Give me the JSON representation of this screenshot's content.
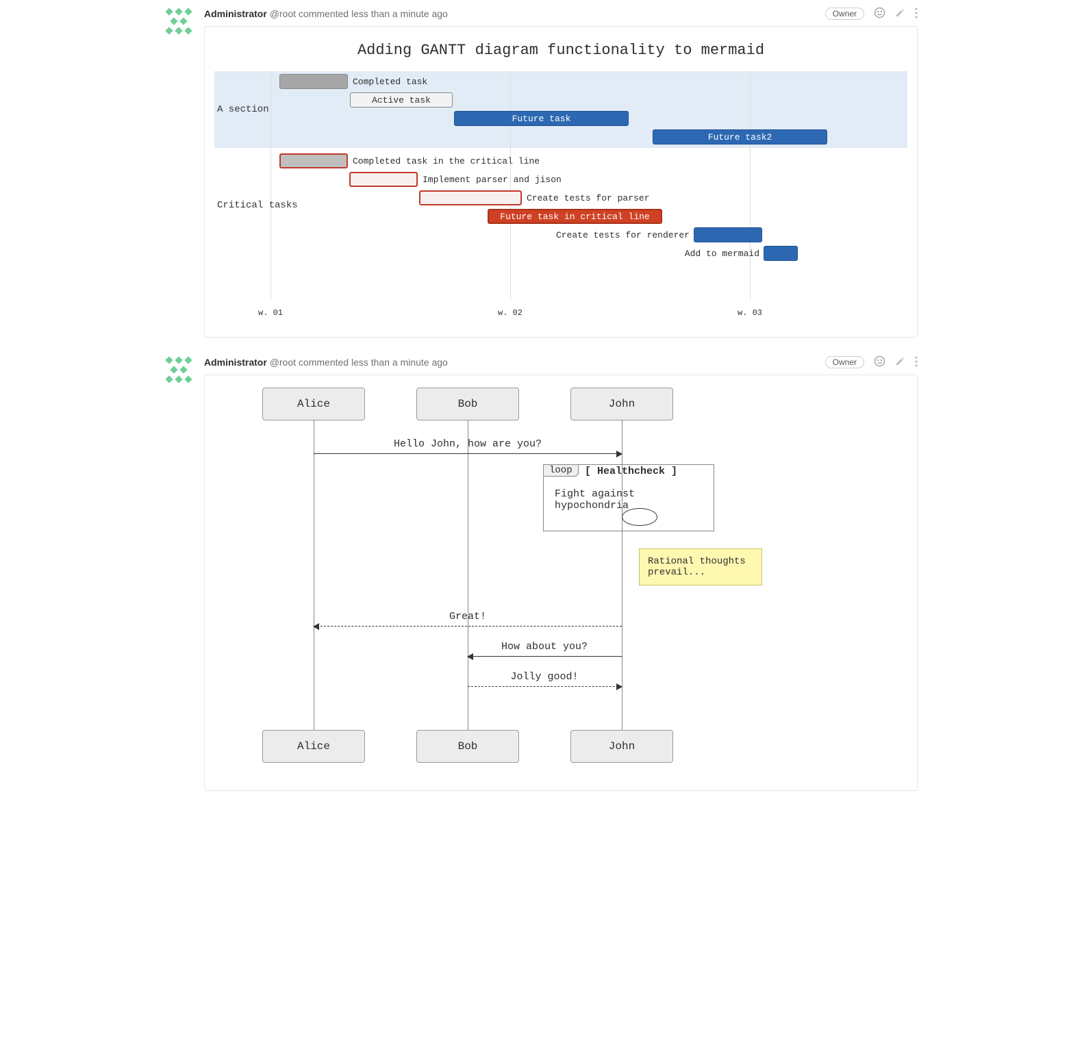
{
  "notes": [
    {
      "author": "Administrator",
      "handle": "@root",
      "meta": "commented less than a minute ago",
      "badge": "Owner"
    },
    {
      "author": "Administrator",
      "handle": "@root",
      "meta": "commented less than a minute ago",
      "badge": "Owner"
    }
  ],
  "gantt": {
    "title": "Adding GANTT diagram functionality to mermaid",
    "sections": [
      {
        "name": "A section",
        "tasks": [
          {
            "label": "Completed task",
            "kind": "done",
            "text_pos": "right"
          },
          {
            "label": "Active task",
            "kind": "active",
            "text_pos": "inside"
          },
          {
            "label": "Future task",
            "kind": "future",
            "text_pos": "inside"
          },
          {
            "label": "Future task2",
            "kind": "future",
            "text_pos": "inside"
          }
        ]
      },
      {
        "name": "Critical tasks",
        "tasks": [
          {
            "label": "Completed task in the critical line",
            "kind": "critdone",
            "text_pos": "right"
          },
          {
            "label": "Implement parser and jison",
            "kind": "critact",
            "text_pos": "right"
          },
          {
            "label": "Create tests for parser",
            "kind": "critact",
            "text_pos": "right"
          },
          {
            "label": "Future task in critical line",
            "kind": "crit",
            "text_pos": "inside"
          },
          {
            "label": "Create tests for renderer",
            "kind": "small",
            "text_pos": "left"
          },
          {
            "label": "Add to mermaid",
            "kind": "small",
            "text_pos": "left"
          }
        ]
      }
    ],
    "ticks": [
      "w. 01",
      "w. 02",
      "w. 03"
    ]
  },
  "seq": {
    "actors": [
      "Alice",
      "Bob",
      "John"
    ],
    "messages": [
      {
        "text": "Hello John, how are you?",
        "from": 0,
        "to": 2,
        "style": "solid"
      },
      {
        "text": "Great!",
        "from": 2,
        "to": 0,
        "style": "dashed"
      },
      {
        "text": "How about you?",
        "from": 2,
        "to": 1,
        "style": "solid"
      },
      {
        "text": "Jolly good!",
        "from": 1,
        "to": 2,
        "style": "dashed"
      }
    ],
    "loop": {
      "tab": "loop",
      "title": "[ Healthcheck ]",
      "note": "Fight against hypochondria"
    },
    "sticky": "Rational thoughts prevail..."
  },
  "chart_data": {
    "type": "gantt",
    "title": "Adding GANTT diagram functionality to mermaid",
    "time_axis_ticks": [
      "w. 01",
      "w. 02",
      "w. 03"
    ],
    "sections": [
      {
        "name": "A section",
        "tasks": [
          {
            "label": "Completed task",
            "status": "done",
            "start_week": 1.0,
            "end_week": 1.3
          },
          {
            "label": "Active task",
            "status": "active",
            "start_week": 1.3,
            "end_week": 1.7
          },
          {
            "label": "Future task",
            "status": "future",
            "start_week": 1.7,
            "end_week": 2.4
          },
          {
            "label": "Future task2",
            "status": "future",
            "start_week": 2.4,
            "end_week": 3.1
          }
        ]
      },
      {
        "name": "Critical tasks",
        "tasks": [
          {
            "label": "Completed task in the critical line",
            "status": "critical-done",
            "start_week": 1.0,
            "end_week": 1.3
          },
          {
            "label": "Implement parser and jison",
            "status": "critical-active",
            "start_week": 1.3,
            "end_week": 1.6
          },
          {
            "label": "Create tests for parser",
            "status": "critical-active",
            "start_week": 1.6,
            "end_week": 2.0
          },
          {
            "label": "Future task in critical line",
            "status": "critical",
            "start_week": 2.0,
            "end_week": 2.6
          },
          {
            "label": "Create tests for renderer",
            "status": "future",
            "start_week": 2.6,
            "end_week": 2.9
          },
          {
            "label": "Add to mermaid",
            "status": "future",
            "start_week": 2.9,
            "end_week": 3.0
          }
        ]
      }
    ]
  }
}
